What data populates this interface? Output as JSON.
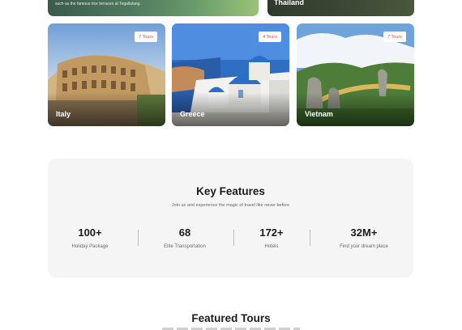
{
  "top_cards": {
    "bali_caption": "such as the famous rice terraces at Tegallalang.",
    "thailand_name": "Thailand"
  },
  "destinations": [
    {
      "name": "Italy",
      "tours": "7 Tours"
    },
    {
      "name": "Greece",
      "tours": "4 Tours"
    },
    {
      "name": "Vietnam",
      "tours": "7 Tours"
    }
  ],
  "key_features": {
    "title": "Key Features",
    "subtitle": "Join us and experience the magic of travel like never before",
    "stats": [
      {
        "value": "100+",
        "label": "Holiday Package"
      },
      {
        "value": "68",
        "label": "Elite Transportation"
      },
      {
        "value": "172+",
        "label": "Hotels"
      },
      {
        "value": "32M+",
        "label": "Find your dream place"
      }
    ]
  },
  "featured_tours": {
    "title": "Featured Tours"
  },
  "colors": {
    "badge_text": "#e04b3c",
    "panel_bg": "#f5f5f5"
  }
}
